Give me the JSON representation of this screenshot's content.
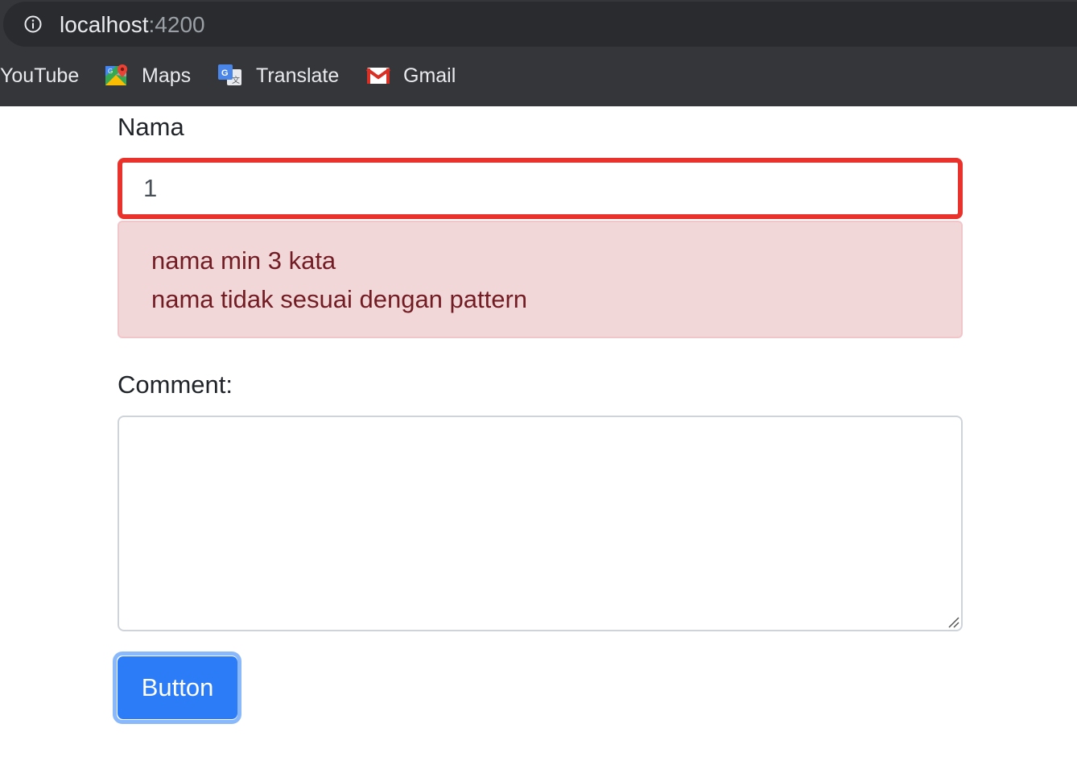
{
  "browser": {
    "url_host": "localhost",
    "url_port": ":4200",
    "bookmarks": [
      {
        "label": "YouTube",
        "icon": "youtube-icon"
      },
      {
        "label": "Maps",
        "icon": "maps-icon"
      },
      {
        "label": "Translate",
        "icon": "translate-icon"
      },
      {
        "label": "Gmail",
        "icon": "gmail-icon"
      }
    ]
  },
  "form": {
    "name_label": "Nama",
    "name_value": "1",
    "errors": [
      "nama min 3 kata",
      "nama tidak sesuai dengan pattern"
    ],
    "comment_label": "Comment:",
    "comment_value": "",
    "button_label": "Button"
  },
  "colors": {
    "invalid_border": "#e8322b",
    "alert_bg": "#f2d7d9",
    "alert_text": "#721c24",
    "button_bg": "#2b7cf6",
    "focus_ring": "#8ab9fb"
  }
}
